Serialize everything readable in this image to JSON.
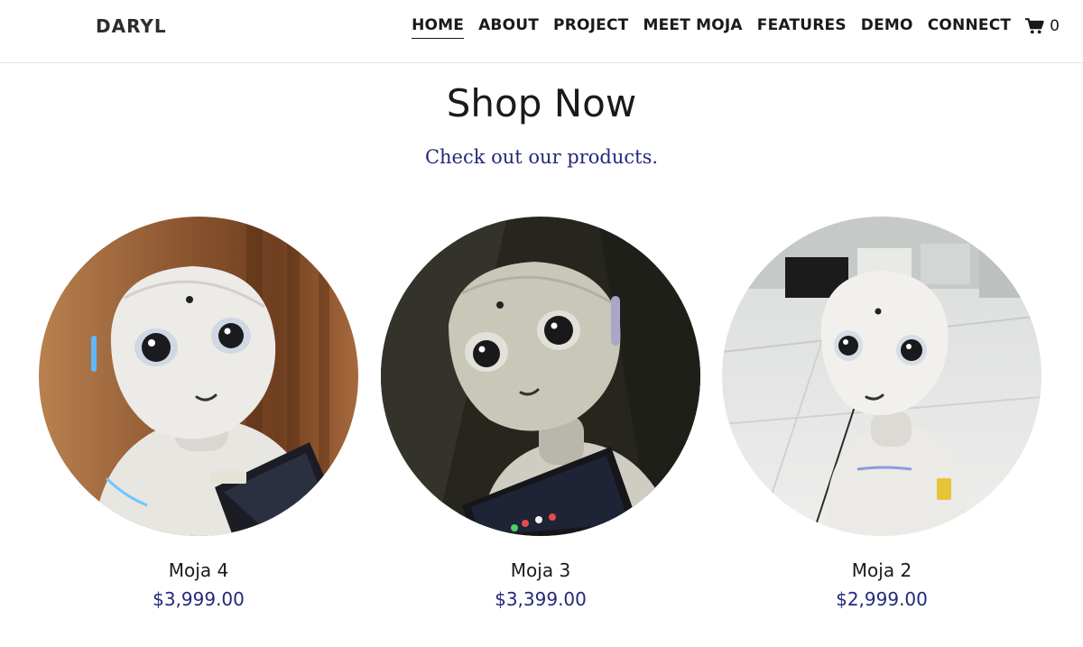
{
  "header": {
    "brand": "DARYL",
    "nav": [
      {
        "label": "HOME",
        "active": true
      },
      {
        "label": "ABOUT",
        "active": false
      },
      {
        "label": "PROJECT",
        "active": false
      },
      {
        "label": "MEET MOJA",
        "active": false
      },
      {
        "label": "FEATURES",
        "active": false
      },
      {
        "label": "DEMO",
        "active": false
      },
      {
        "label": "CONNECT",
        "active": false
      }
    ],
    "cart": {
      "icon": "shopping-cart-icon",
      "count": "0"
    }
  },
  "hero": {
    "title": "Shop Now",
    "subtitle": "Check out our products."
  },
  "products": [
    {
      "name": "Moja 4",
      "price": "$3,999.00",
      "image": "robot-photo"
    },
    {
      "name": "Moja 3",
      "price": "$3,399.00",
      "image": "robot-photo"
    },
    {
      "name": "Moja 2",
      "price": "$2,999.00",
      "image": "robot-photo"
    }
  ],
  "colors": {
    "accent": "#23297a",
    "text": "#1a1a1a",
    "divider": "#e3e3e3"
  }
}
